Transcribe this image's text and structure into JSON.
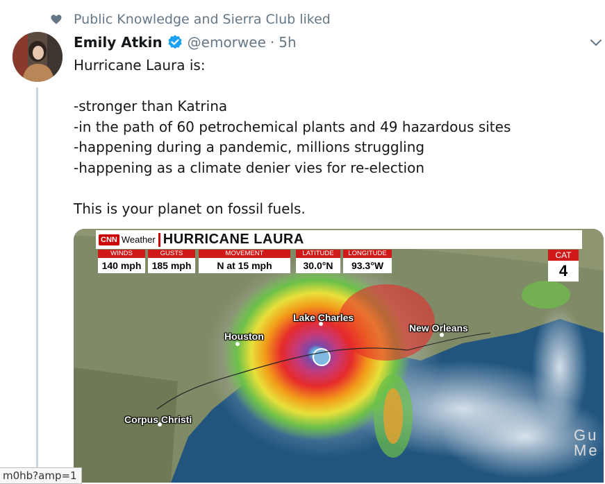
{
  "social_context": {
    "text": "Public Knowledge and Sierra Club liked",
    "icon": "heart-icon"
  },
  "tweet": {
    "author_name": "Emily Atkin",
    "handle": "@emorwee",
    "separator": "·",
    "time": "5h",
    "verified": true,
    "text": "Hurricane Laura is:\n\n-stronger than Katrina\n-in the path of 60 petrochemical plants and 49 hazardous sites\n-happening during a pandemic, millions struggling\n-happening as a climate denier vies for re-election\n\nThis is your planet on fossil fuels."
  },
  "media": {
    "network": "CNN",
    "network_sub": "Weather",
    "headline": "HURRICANE LAURA",
    "stats": [
      {
        "label": "WINDS",
        "value": "140 mph"
      },
      {
        "label": "GUSTS",
        "value": "185 mph"
      },
      {
        "label": "MOVEMENT",
        "value": "N at 15 mph"
      },
      {
        "label": "LATITUDE",
        "value": "30.0°N"
      },
      {
        "label": "LONGITUDE",
        "value": "93.3°W"
      }
    ],
    "category": {
      "label": "CAT",
      "value": "4"
    },
    "cities": [
      "Lake Charles",
      "New Orleans",
      "Houston",
      "Corpus Christi"
    ],
    "gulf_label": "Gu\nMe"
  },
  "status_bar": {
    "url": "m0hb?amp=1"
  },
  "colors": {
    "verified": "#1da1f2",
    "cnn_red": "#cc0000",
    "muted": "#657786",
    "thread_line": "#ccd6dd"
  }
}
